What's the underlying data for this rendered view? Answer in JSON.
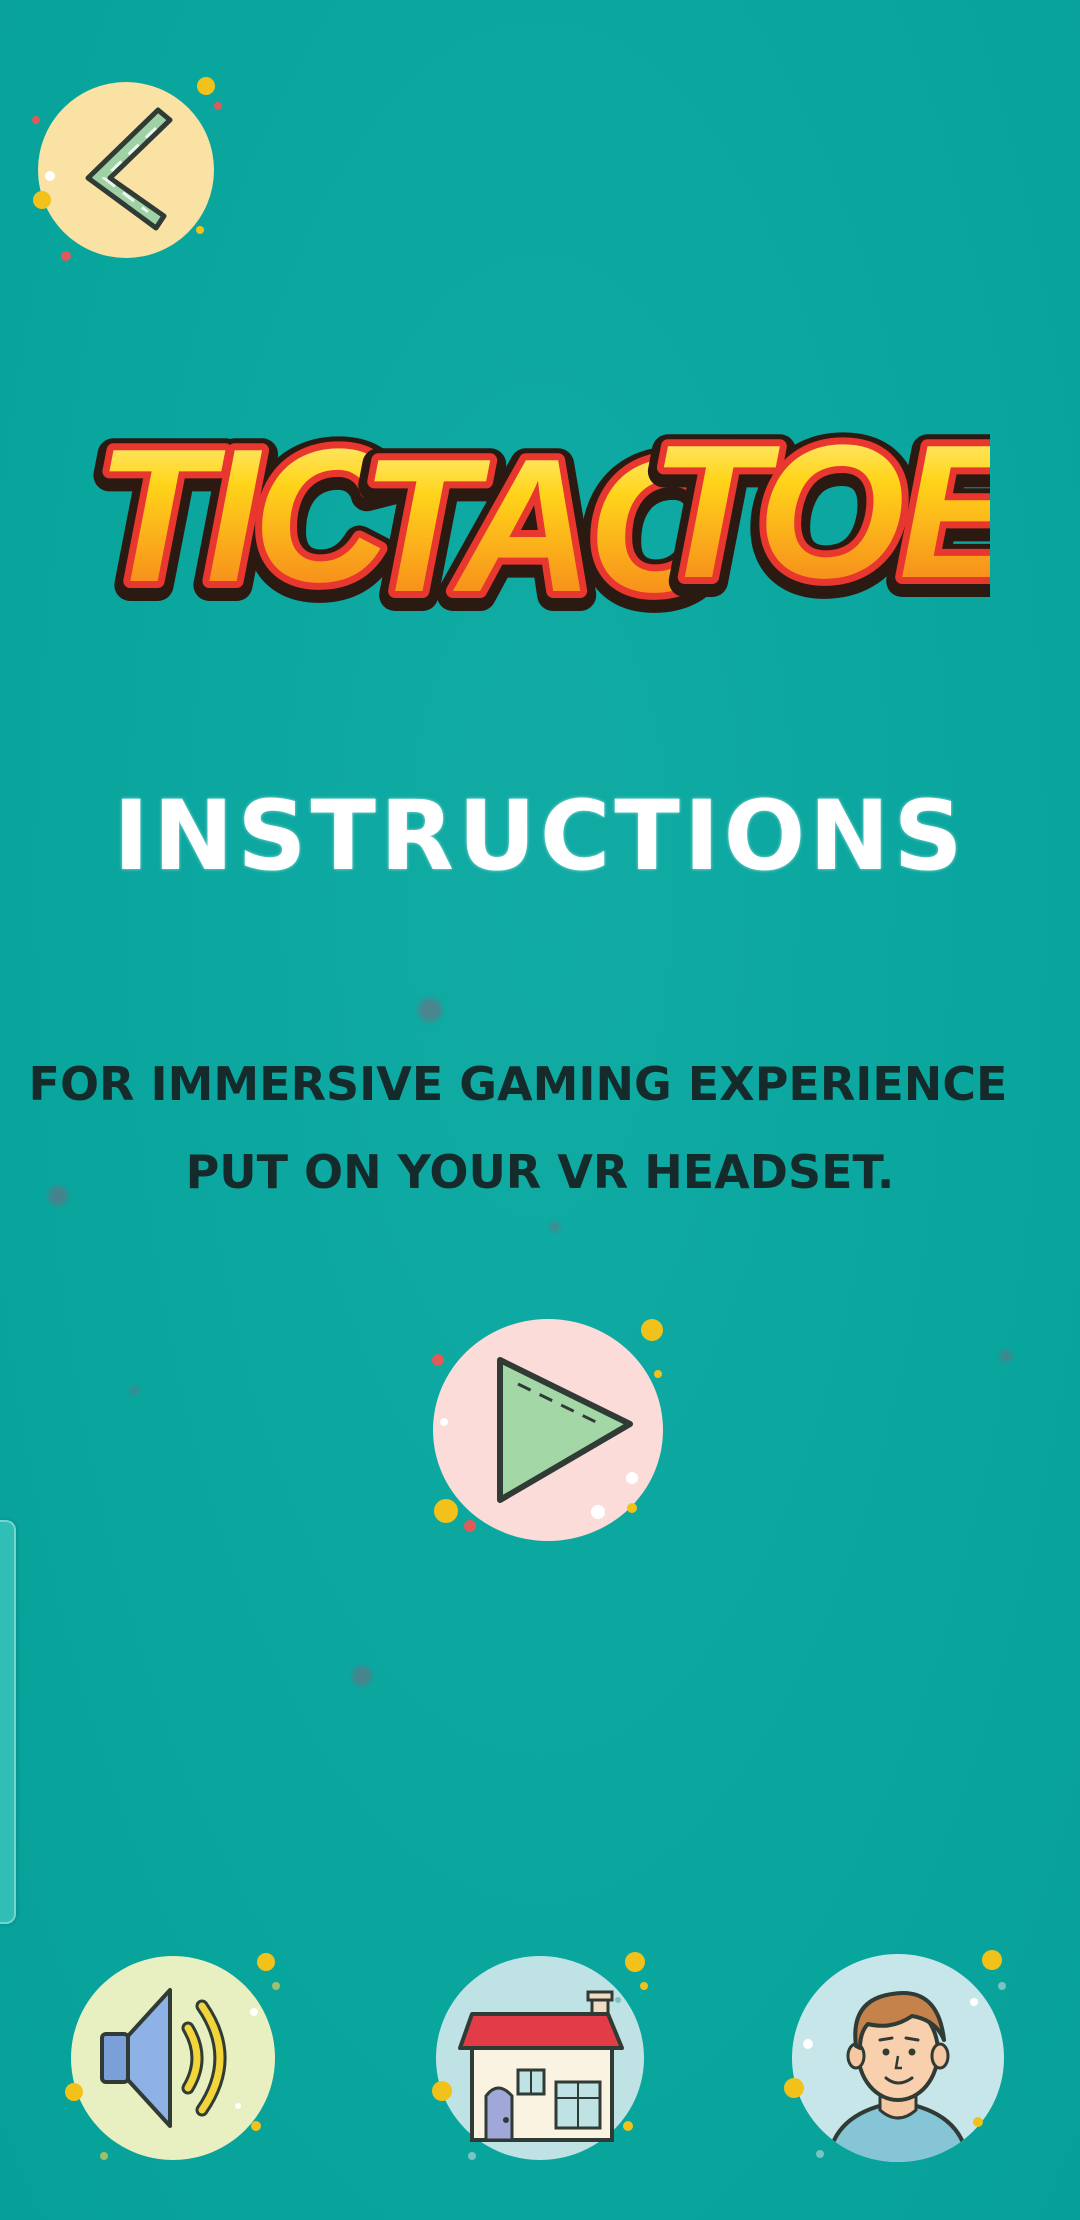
{
  "game": {
    "title": "TIC TAC TOE",
    "title_words": [
      "TIC",
      "TAC",
      "TOE"
    ]
  },
  "instructions": {
    "heading": "INSTRUCTIONS",
    "line1": "FOR IMMERSIVE GAMING EXPERIENCE",
    "line2": "PUT ON YOUR VR HEADSET."
  },
  "buttons": {
    "back": {
      "icon": "chevron-left-icon"
    },
    "play": {
      "icon": "play-icon"
    },
    "sound": {
      "icon": "speaker-icon"
    },
    "home": {
      "icon": "house-icon"
    },
    "profile": {
      "icon": "avatar-icon"
    }
  },
  "colors": {
    "background": "#0aa8a0",
    "heading_text": "#ffffff",
    "body_text": "#152b2b",
    "back_bg": "#f9e2a3",
    "play_bg": "#fbdcd8",
    "sound_bg": "#e8efc0",
    "home_bg": "#bfe3e4",
    "profile_bg": "#c7e6ea",
    "title_fill_top": "#ffd41a",
    "title_fill_bottom": "#f4761c",
    "title_outline": "#e8372e"
  }
}
